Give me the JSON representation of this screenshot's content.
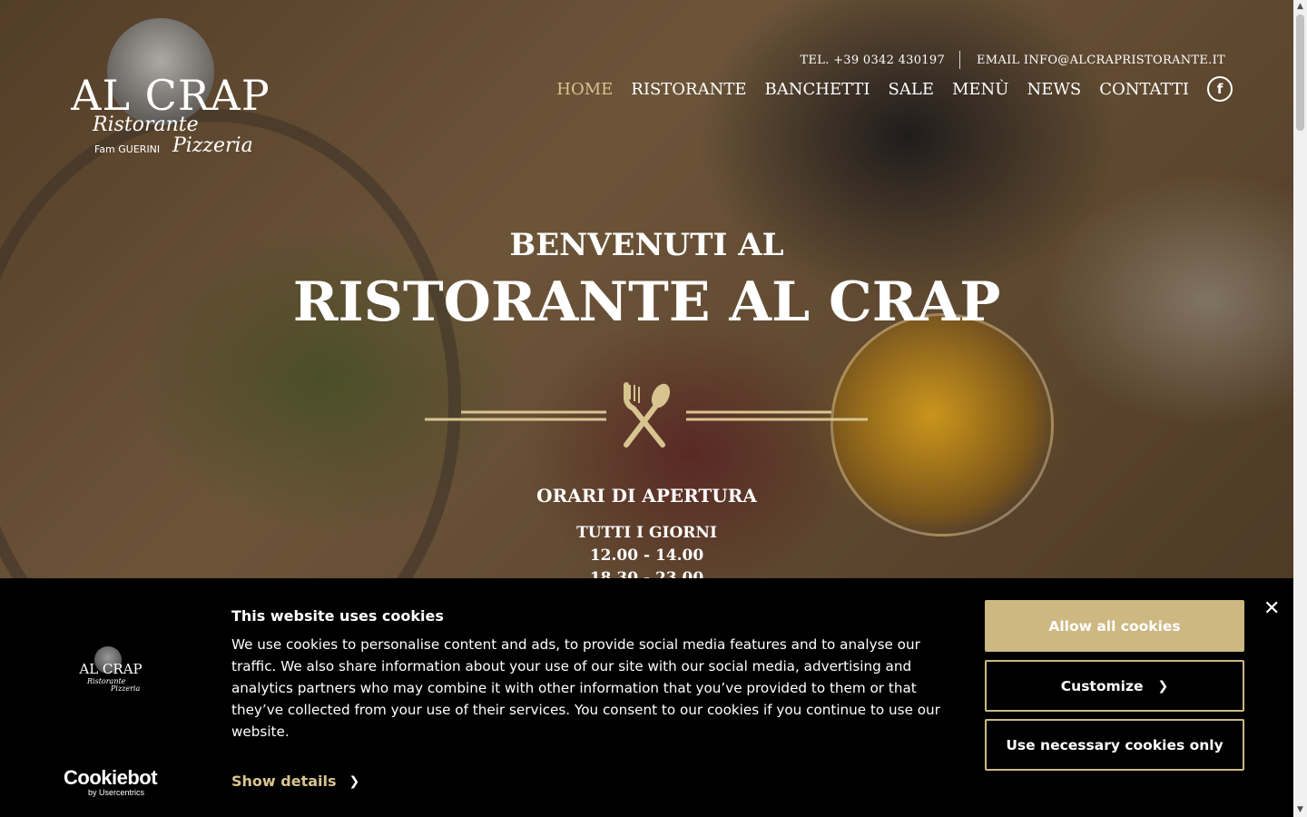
{
  "logo": {
    "wordmark": "AL CRAP",
    "line1": "Ristorante",
    "line2": "Fam GUERINI",
    "line3": "Pizzeria"
  },
  "header": {
    "phone": "TEL. +39 0342 430197",
    "email": "EMAIL INFO@ALCRAPRISTORANTE.IT",
    "nav": [
      {
        "label": "HOME",
        "active": true
      },
      {
        "label": "RISTORANTE"
      },
      {
        "label": "BANCHETTI"
      },
      {
        "label": "SALE"
      },
      {
        "label": "MENÙ"
      },
      {
        "label": "NEWS"
      },
      {
        "label": "CONTATTI"
      }
    ],
    "facebook_icon": "facebook-icon",
    "facebook_glyph": "f"
  },
  "hero": {
    "welcome": "BENVENUTI AL",
    "name": "RISTORANTE AL CRAP",
    "divider_icon": "fork-spoon-icon",
    "hours_title": "ORARI DI APERTURA",
    "hours": [
      "TUTTI I GIORNI",
      "12.00 - 14.00",
      "18.30 - 23.00"
    ]
  },
  "cookie": {
    "title": "This website uses cookies",
    "body": "We use cookies to personalise content and ads, to provide social media features and to analyse our traffic. We also share information about your use of our site with our social media, advertising and analytics partners who may combine it with other information that you’ve provided to them or that they’ve collected from your use of their services. You consent to our cookies if you continue to use our website.",
    "show_details": "Show details",
    "allow_all": "Allow all cookies",
    "customize": "Customize",
    "necessary_only": "Use necessary cookies only",
    "close_glyph": "✕",
    "brand": "Cookiebot",
    "brand_sub": "by Usercentrics"
  },
  "colors": {
    "accent": "#cdb882",
    "nav_active": "#d8c48f",
    "banner_bg": "#000000"
  }
}
